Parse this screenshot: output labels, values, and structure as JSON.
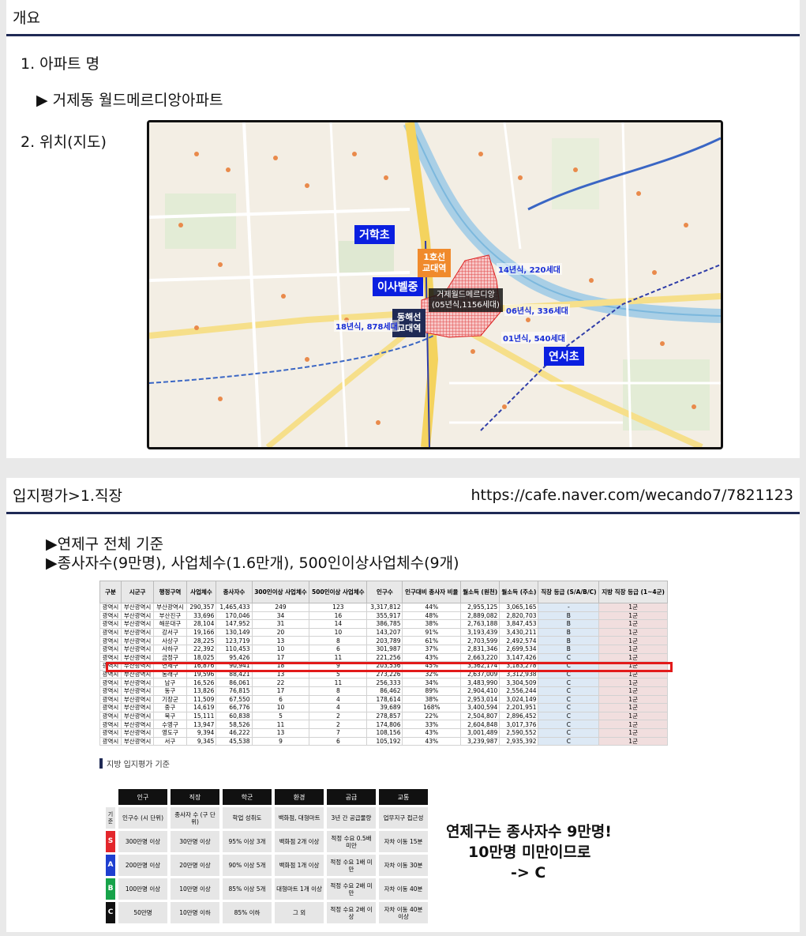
{
  "slide1": {
    "header": "개요",
    "item1": "1.  아파트 명",
    "item1_sub": "▶ 거제동 월드메르디앙아파트",
    "item2": "2. 위치(지도)",
    "map": {
      "schools": [
        "거학초",
        "이사벨중",
        "연서초"
      ],
      "station1": [
        "1호선",
        "교대역"
      ],
      "station2": [
        "동해선",
        "교대역"
      ],
      "apt": [
        "거제월드메르디앙",
        "(05년식,1156세대)"
      ],
      "notes": [
        "14년식, 220세대",
        "06년식, 336세대",
        "18년식, 878세대",
        "01년식, 540세대"
      ]
    }
  },
  "slide2": {
    "header": "입지평가>1.직장",
    "url": "https://cafe.naver.com/wecando7/7821123",
    "bullet1": "▶연제구 전체 기준",
    "bullet2": "▶종사자수(9만명), 사업체수(1.6만개), 500인이상사업체수(9개)",
    "table": {
      "headers": [
        "구분",
        "시군구",
        "행정구역",
        "사업체수",
        "종사자수",
        "300인이상 사업체수",
        "500인이상 사업체수",
        "인구수",
        "인구대비 종사자 비율",
        "월소득 (원천)",
        "월소득 (주소)",
        "직장 등급 (S/A/B/C)",
        "지방 직장 등급 (1~4군)"
      ],
      "rows": [
        [
          "광역시",
          "부산광역시",
          "부산광역시",
          "290,357",
          "1,465,433",
          "249",
          "123",
          "3,317,812",
          "44%",
          "2,955,125",
          "3,065,165",
          "-",
          "1군"
        ],
        [
          "광역시",
          "부산광역시",
          "부산진구",
          "33,696",
          "170,046",
          "34",
          "16",
          "355,917",
          "48%",
          "2,889,082",
          "2,820,703",
          "B",
          "1군"
        ],
        [
          "광역시",
          "부산광역시",
          "해운대구",
          "28,104",
          "147,952",
          "31",
          "14",
          "386,785",
          "38%",
          "2,763,188",
          "3,847,453",
          "B",
          "1군"
        ],
        [
          "광역시",
          "부산광역시",
          "강서구",
          "19,166",
          "130,149",
          "20",
          "10",
          "143,207",
          "91%",
          "3,193,439",
          "3,430,211",
          "B",
          "1군"
        ],
        [
          "광역시",
          "부산광역시",
          "사상구",
          "28,225",
          "123,719",
          "13",
          "8",
          "203,789",
          "61%",
          "2,703,599",
          "2,492,574",
          "B",
          "1군"
        ],
        [
          "광역시",
          "부산광역시",
          "사하구",
          "22,392",
          "110,453",
          "10",
          "6",
          "301,987",
          "37%",
          "2,831,346",
          "2,699,534",
          "B",
          "1군"
        ],
        [
          "광역시",
          "부산광역시",
          "금정구",
          "18,025",
          "95,426",
          "17",
          "11",
          "221,256",
          "43%",
          "2,663,220",
          "3,147,426",
          "C",
          "1군"
        ],
        [
          "광역시",
          "부산광역시",
          "연제구",
          "16,876",
          "90,941",
          "18",
          "9",
          "203,536",
          "45%",
          "3,362,174",
          "3,183,278",
          "C",
          "1군"
        ],
        [
          "광역시",
          "부산광역시",
          "동래구",
          "19,596",
          "88,421",
          "13",
          "5",
          "273,226",
          "32%",
          "2,637,009",
          "3,312,938",
          "C",
          "1군"
        ],
        [
          "광역시",
          "부산광역시",
          "남구",
          "16,526",
          "86,061",
          "22",
          "11",
          "256,333",
          "34%",
          "3,483,990",
          "3,304,509",
          "C",
          "1군"
        ],
        [
          "광역시",
          "부산광역시",
          "동구",
          "13,826",
          "76,815",
          "17",
          "8",
          "86,462",
          "89%",
          "2,904,410",
          "2,556,244",
          "C",
          "1군"
        ],
        [
          "광역시",
          "부산광역시",
          "기장군",
          "11,509",
          "67,550",
          "6",
          "4",
          "178,614",
          "38%",
          "2,953,014",
          "3,024,149",
          "C",
          "1군"
        ],
        [
          "광역시",
          "부산광역시",
          "중구",
          "14,619",
          "66,776",
          "10",
          "4",
          "39,689",
          "168%",
          "3,400,594",
          "2,201,951",
          "C",
          "1군"
        ],
        [
          "광역시",
          "부산광역시",
          "북구",
          "15,111",
          "60,838",
          "5",
          "2",
          "278,857",
          "22%",
          "2,504,807",
          "2,896,452",
          "C",
          "1군"
        ],
        [
          "광역시",
          "부산광역시",
          "수영구",
          "13,947",
          "58,526",
          "11",
          "2",
          "174,806",
          "33%",
          "2,604,848",
          "3,017,376",
          "C",
          "1군"
        ],
        [
          "광역시",
          "부산광역시",
          "영도구",
          "9,394",
          "46,222",
          "13",
          "7",
          "108,156",
          "43%",
          "3,001,489",
          "2,590,552",
          "C",
          "1군"
        ],
        [
          "광역시",
          "부산광역시",
          "서구",
          "9,345",
          "45,538",
          "9",
          "6",
          "105,192",
          "43%",
          "3,239,987",
          "2,935,392",
          "C",
          "1군"
        ]
      ]
    },
    "legend_title": "지방 입지평가 기준",
    "criteria": {
      "headers": [
        "인구",
        "직장",
        "학군",
        "환경",
        "공급",
        "교통"
      ],
      "sub_label": "기준",
      "subheaders": [
        "인구수 (시 단위)",
        "종사자 수 (구 단위)",
        "학업 성취도",
        "백화점, 대형마트",
        "3년 간 공급물량",
        "업무지구 접근성"
      ],
      "rows": [
        {
          "grade": "S",
          "color": "#e3262b",
          "cells": [
            "300만명 이상",
            "30만명 이상",
            "95% 이상 3개",
            "백화점 2개 이상",
            "적정 수요 0.5배 미만",
            "자차 이동 15분"
          ]
        },
        {
          "grade": "A",
          "color": "#1e3fd0",
          "cells": [
            "200만명 이상",
            "20만명 이상",
            "90% 이상 5개",
            "백화점 1개 이상",
            "적정 수요 1배 미만",
            "자차 이동 30분"
          ]
        },
        {
          "grade": "B",
          "color": "#17a34a",
          "cells": [
            "100만명 이상",
            "10만명 이상",
            "85% 이상 5개",
            "대형마트 1개 이상",
            "적정 수요 2배 미만",
            "자차 이동 40분"
          ]
        },
        {
          "grade": "C",
          "color": "#111111",
          "cells": [
            "50만명",
            "10만명 이하",
            "85% 이하",
            "그 외",
            "적정 수요 2배 이상",
            "자차 이동 40분 이상"
          ]
        }
      ]
    },
    "note": [
      "연제구는 종사자수 9만명!",
      "10만명 미만이므로",
      "-> C"
    ]
  }
}
